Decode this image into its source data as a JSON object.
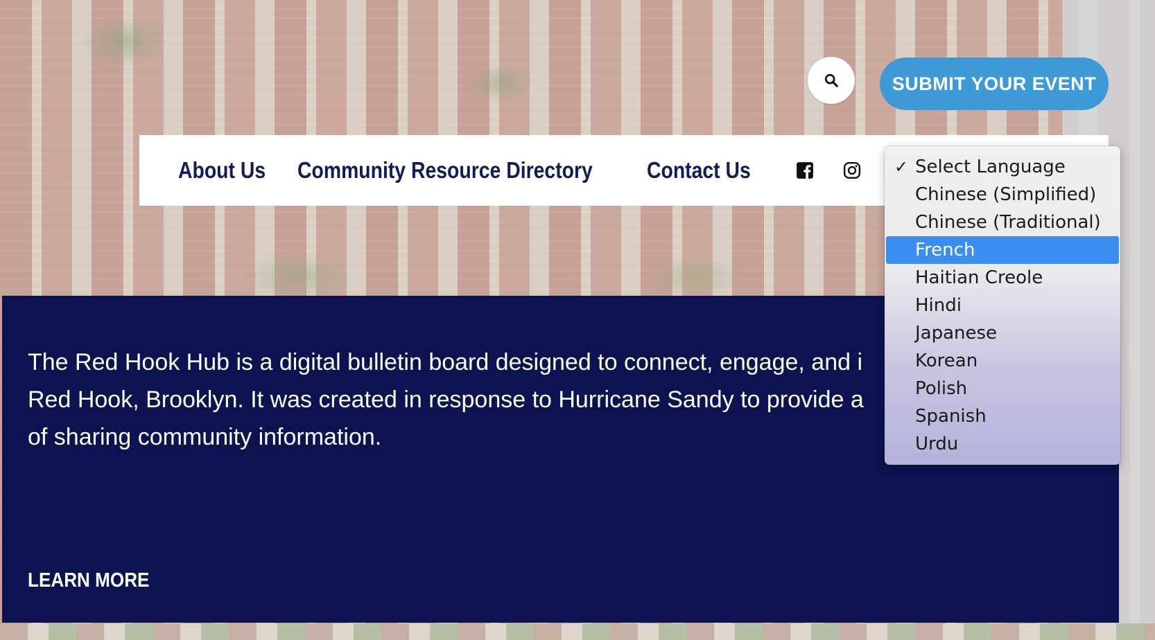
{
  "header": {
    "search_icon": "search-icon",
    "submit_label": "SUBMIT YOUR EVENT"
  },
  "nav": {
    "items": [
      {
        "label": "About Us"
      },
      {
        "label": "Community Resource Directory"
      },
      {
        "label": "Contact Us"
      }
    ],
    "social": [
      {
        "icon": "facebook-icon"
      },
      {
        "icon": "instagram-icon"
      }
    ]
  },
  "language_dropdown": {
    "checkmark": "✓",
    "selected": "Select Language",
    "highlighted": "French",
    "options": [
      "Select Language",
      "Chinese (Simplified)",
      "Chinese (Traditional)",
      "French",
      "Haitian Creole",
      "Hindi",
      "Japanese",
      "Korean",
      "Polish",
      "Spanish",
      "Urdu"
    ]
  },
  "hero": {
    "text": "The Red Hook Hub is a digital bulletin board designed to connect, engage, and i\nRed Hook, Brooklyn. It was created in response to Hurricane Sandy to provide a \nof sharing community information.",
    "cta": "LEARN MORE"
  },
  "colors": {
    "navy": "#0c1350",
    "nav_text": "#141c54",
    "accent_blue": "#3d9ad7",
    "highlight": "#3a8ef0"
  }
}
